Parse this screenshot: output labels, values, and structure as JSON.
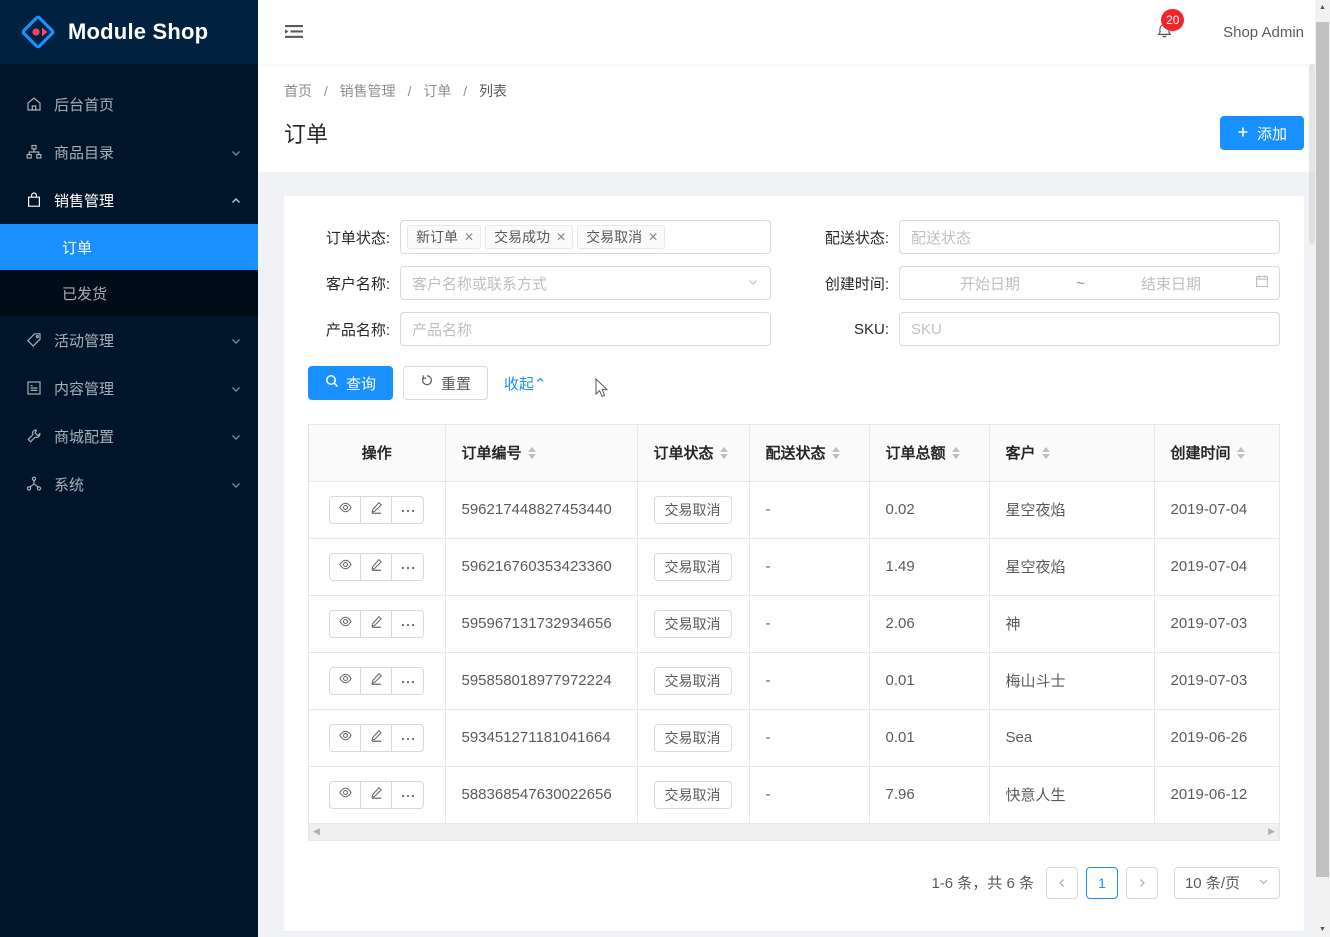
{
  "brand": {
    "title": "Module Shop",
    "logo_icon": "diamond-logo-icon",
    "accent": "#1890ff",
    "sidebar_bg": "#001529",
    "logo_bar_bg": "#002140"
  },
  "sidebar": {
    "items": [
      {
        "label": "后台首页",
        "icon": "home-icon",
        "has_children": false
      },
      {
        "label": "商品目录",
        "icon": "cluster-icon",
        "has_children": true,
        "expanded": false
      },
      {
        "label": "销售管理",
        "icon": "shopping-bag-icon",
        "has_children": true,
        "expanded": true,
        "children": [
          {
            "label": "订单",
            "selected": true
          },
          {
            "label": "已发货",
            "selected": false
          }
        ]
      },
      {
        "label": "活动管理",
        "icon": "tag-icon",
        "has_children": true,
        "expanded": false
      },
      {
        "label": "内容管理",
        "icon": "profile-icon",
        "has_children": true,
        "expanded": false
      },
      {
        "label": "商城配置",
        "icon": "tool-icon",
        "has_children": true,
        "expanded": false
      },
      {
        "label": "系统",
        "icon": "deployment-unit-icon",
        "has_children": true,
        "expanded": false
      }
    ]
  },
  "topbar": {
    "fold_icon": "menu-fold-icon",
    "bell_icon": "bell-icon",
    "notification_count": "20",
    "notification_color": "#f5222d",
    "user_name": "Shop Admin"
  },
  "breadcrumb": {
    "items": [
      "首页",
      "销售管理",
      "订单",
      "列表"
    ],
    "separator": "/"
  },
  "page": {
    "title": "订单",
    "add_button": "添加",
    "add_icon": "plus-icon"
  },
  "filters": {
    "order_status": {
      "label": "订单状态:",
      "tags": [
        "新订单",
        "交易成功",
        "交易取消"
      ],
      "tag_close_icon": "close-icon"
    },
    "delivery_status": {
      "label": "配送状态:",
      "placeholder": "配送状态",
      "value": ""
    },
    "customer_name": {
      "label": "客户名称:",
      "placeholder": "客户名称或联系方式",
      "value": "",
      "caret_icon": "chevron-down-icon"
    },
    "create_time": {
      "label": "创建时间:",
      "start_placeholder": "开始日期",
      "end_placeholder": "结束日期",
      "separator": "~",
      "calendar_icon": "calendar-icon"
    },
    "product_name": {
      "label": "产品名称:",
      "placeholder": "产品名称",
      "value": ""
    },
    "sku": {
      "label": "SKU:",
      "placeholder": "SKU",
      "value": ""
    },
    "actions": {
      "search_label": "查询",
      "search_icon": "search-icon",
      "reset_label": "重置",
      "reset_icon": "reload-icon",
      "collapse_label": "收起",
      "collapse_icon": "chevron-up-icon"
    }
  },
  "table": {
    "columns": [
      {
        "key": "op",
        "label": "操作",
        "sortable": false
      },
      {
        "key": "order_no",
        "label": "订单编号",
        "sortable": true
      },
      {
        "key": "order_status",
        "label": "订单状态",
        "sortable": true
      },
      {
        "key": "delivery_status",
        "label": "配送状态",
        "sortable": true
      },
      {
        "key": "total",
        "label": "订单总额",
        "sortable": true
      },
      {
        "key": "customer",
        "label": "客户",
        "sortable": true
      },
      {
        "key": "created_at",
        "label": "创建时间",
        "sortable": true
      }
    ],
    "row_actions": [
      {
        "name": "view",
        "icon": "eye-icon"
      },
      {
        "name": "edit",
        "icon": "pencil-icon"
      },
      {
        "name": "more",
        "icon": "ellipsis-icon"
      }
    ],
    "rows": [
      {
        "order_no": "596217448827453440",
        "order_status": "交易取消",
        "delivery_status": "-",
        "total": "0.02",
        "customer": "星空夜焰",
        "created_at": "2019-07-04"
      },
      {
        "order_no": "596216760353423360",
        "order_status": "交易取消",
        "delivery_status": "-",
        "total": "1.49",
        "customer": "星空夜焰",
        "created_at": "2019-07-04"
      },
      {
        "order_no": "595967131732934656",
        "order_status": "交易取消",
        "delivery_status": "-",
        "total": "2.06",
        "customer": "神",
        "created_at": "2019-07-03"
      },
      {
        "order_no": "595858018977972224",
        "order_status": "交易取消",
        "delivery_status": "-",
        "total": "0.01",
        "customer": "梅山斗士",
        "created_at": "2019-07-03"
      },
      {
        "order_no": "593451271181041664",
        "order_status": "交易取消",
        "delivery_status": "-",
        "total": "0.01",
        "customer": "Sea",
        "created_at": "2019-06-26"
      },
      {
        "order_no": "588368547630022656",
        "order_status": "交易取消",
        "delivery_status": "-",
        "total": "7.96",
        "customer": "快意人生",
        "created_at": "2019-06-12"
      }
    ]
  },
  "pagination": {
    "total_text": "1-6 条，共 6 条",
    "prev_icon": "chevron-left-icon",
    "next_icon": "chevron-right-icon",
    "pages": [
      "1"
    ],
    "current_page": "1",
    "page_size_label": "10 条/页",
    "page_size_caret": "chevron-down-icon"
  }
}
